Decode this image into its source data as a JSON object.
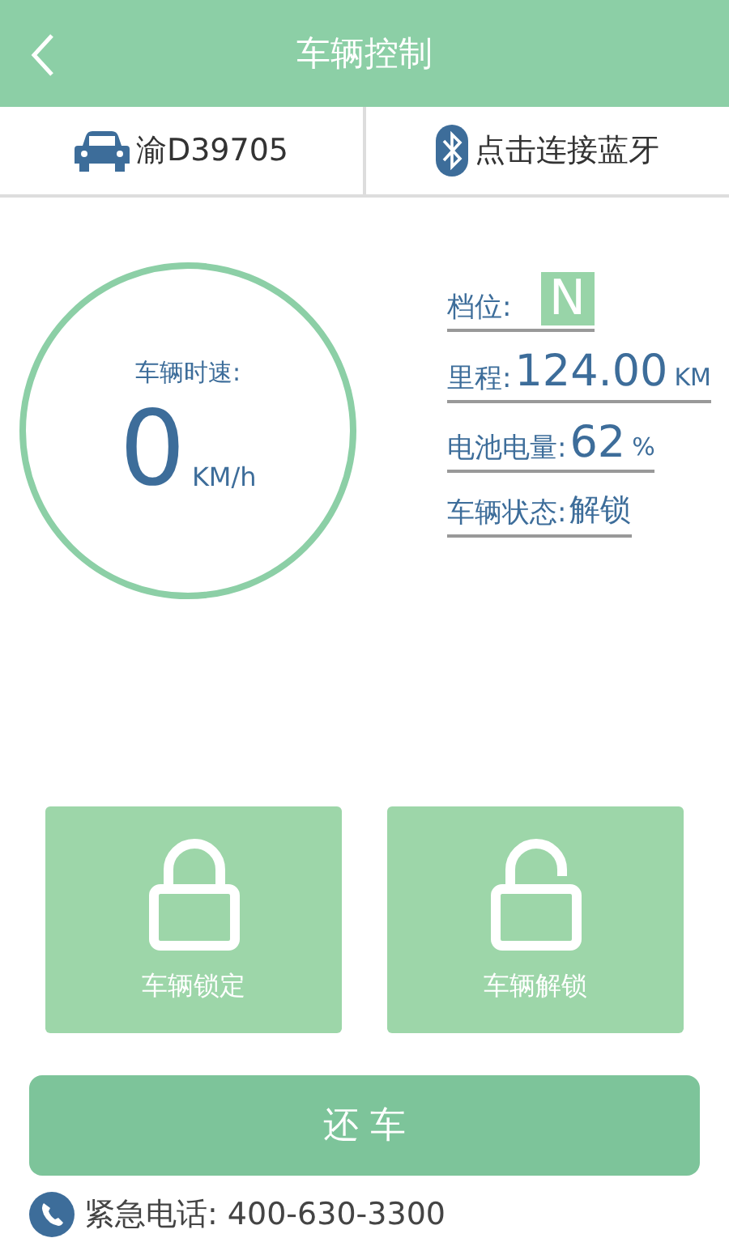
{
  "header": {
    "title": "车辆控制"
  },
  "vehicle": {
    "plate": "渝D39705"
  },
  "bluetooth": {
    "label": "点击连接蓝牙"
  },
  "speed": {
    "label": "车辆时速:",
    "value": "0",
    "unit": "KM/h"
  },
  "stats": [
    {
      "kind": "gear",
      "label": "档位:",
      "value": "N"
    },
    {
      "kind": "reading",
      "label": "里程:",
      "value": "124.00",
      "unit": "KM"
    },
    {
      "kind": "reading",
      "label": "电池电量:",
      "value": "62",
      "unit": "%"
    },
    {
      "kind": "text",
      "label": "车辆状态:",
      "value": "解锁"
    }
  ],
  "actions": [
    {
      "kind": "lock",
      "label": "车辆锁定"
    },
    {
      "kind": "unlock",
      "label": "车辆解锁"
    }
  ],
  "return_button": "还 车",
  "emergency": {
    "label": "紧急电话:",
    "number": "400-630-3300"
  }
}
